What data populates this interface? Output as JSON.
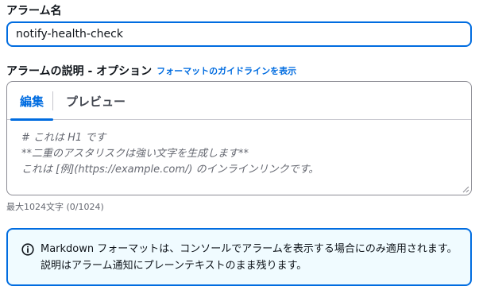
{
  "alarm_name": {
    "label": "アラーム名",
    "value": "notify-health-check"
  },
  "description": {
    "label": "アラームの説明 - オプション",
    "format_link": "フォーマットのガイドラインを表示",
    "tabs": [
      {
        "label": "編集",
        "active": true
      },
      {
        "label": "プレビュー",
        "active": false
      }
    ],
    "placeholder": "# これは H1 です\n**二重のアスタリスクは強い文字を生成します**\nこれは [例](https://example.com/) のインラインリンクです。",
    "value": "",
    "char_count": "最大1024文字 (0/1024)"
  },
  "info": {
    "icon": "info-circle-icon",
    "text": "Markdown フォーマットは、コンソールでアラームを表示する場合にのみ適用されます。説明はアラーム通知にプレーンテキストのまま残ります。"
  },
  "colors": {
    "accent": "#006ce0",
    "info_background": "#f0fbff",
    "text": "#0f141a",
    "muted": "#656871"
  }
}
